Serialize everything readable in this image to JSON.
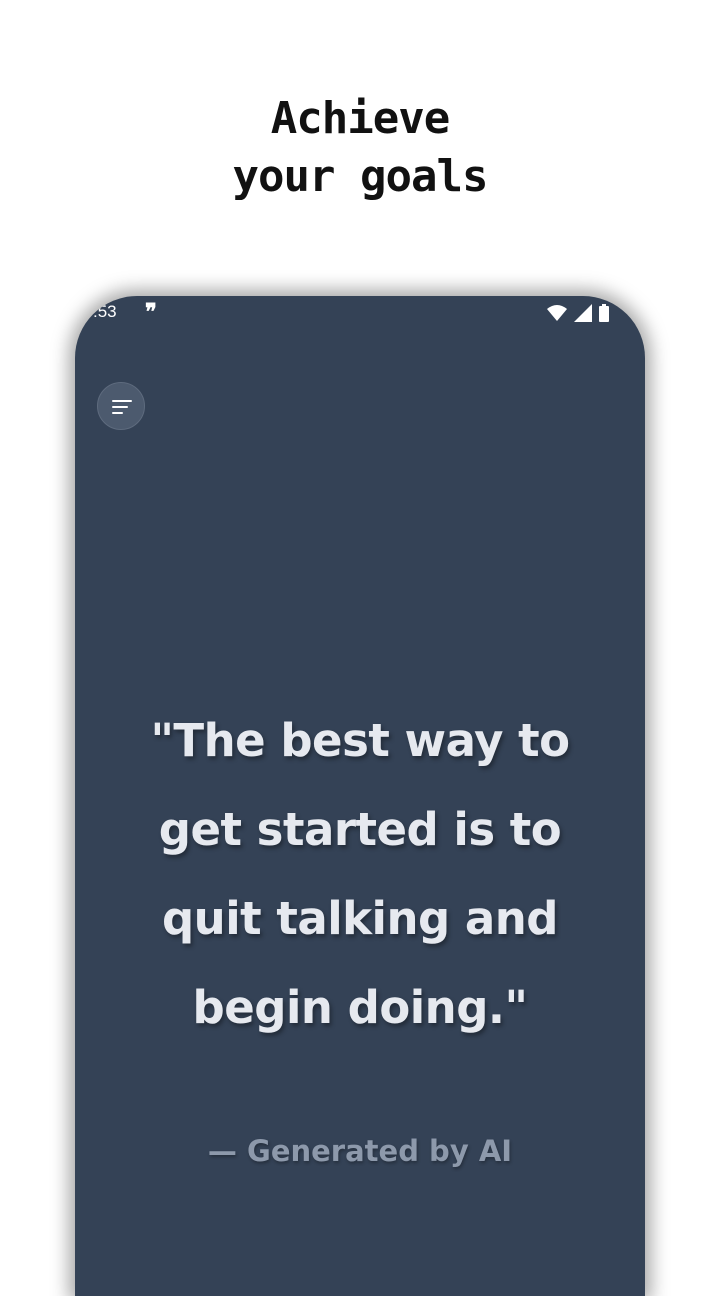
{
  "headline": {
    "line1": "Achieve",
    "line2": "your goals"
  },
  "status_bar": {
    "time": ":53",
    "notification_icon": "quote-icon",
    "icons": [
      "wifi-icon",
      "cellular-signal-icon",
      "battery-icon"
    ]
  },
  "menu_button": {
    "icon": "menu-icon"
  },
  "quote": {
    "text": "\"The best way to get started is to quit talking and begin doing.\"",
    "attribution": "— Generated by AI"
  },
  "colors": {
    "background": "#ffffff",
    "phone_screen": "#344256",
    "quote_text": "#e6e9ef",
    "attribution_text": "#8d99ab"
  }
}
